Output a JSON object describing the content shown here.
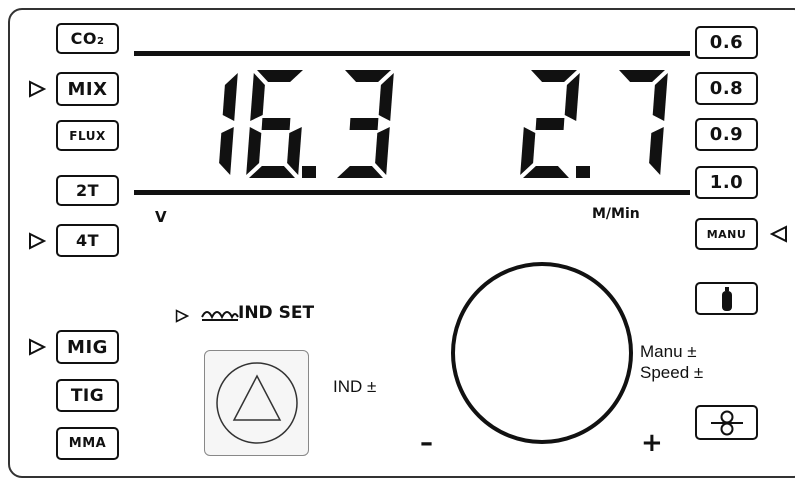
{
  "gas_modes": [
    {
      "label": "CO",
      "sub": "2",
      "selected": false
    },
    {
      "label": "MIX",
      "selected": true
    },
    {
      "label": "FLUX",
      "selected": false
    }
  ],
  "trigger_modes": [
    {
      "label": "2T",
      "selected": false
    },
    {
      "label": "4T",
      "selected": true
    }
  ],
  "process_modes": [
    {
      "label": "MIG",
      "selected": true
    },
    {
      "label": "TIG",
      "selected": false
    },
    {
      "label": "MMA",
      "selected": false
    }
  ],
  "wire_sizes": [
    {
      "label": "0.6",
      "selected": false
    },
    {
      "label": "0.8",
      "selected": false
    },
    {
      "label": "0.9",
      "selected": false
    },
    {
      "label": "1.0",
      "selected": false
    },
    {
      "label": "MANU",
      "selected": true
    }
  ],
  "display": {
    "voltage": "16.3",
    "voltage_unit": "V",
    "wire_speed": "2.7",
    "wire_speed_unit": "M/Min"
  },
  "ind_set": {
    "label": "IND SET",
    "selected": true,
    "icon": "inductance-coil-icon"
  },
  "ind_control_label": "IND ±",
  "knob": {
    "label_line1": "Manu ±",
    "label_line2": "Speed ±",
    "minus": "–",
    "plus": "+"
  },
  "icons": {
    "gas_cylinder": "gas-cylinder-icon",
    "wire_spool": "wire-feed-icon"
  },
  "colors": {
    "ink": "#111111",
    "panel": "#ffffff",
    "button_face": "#f6f6f6"
  }
}
